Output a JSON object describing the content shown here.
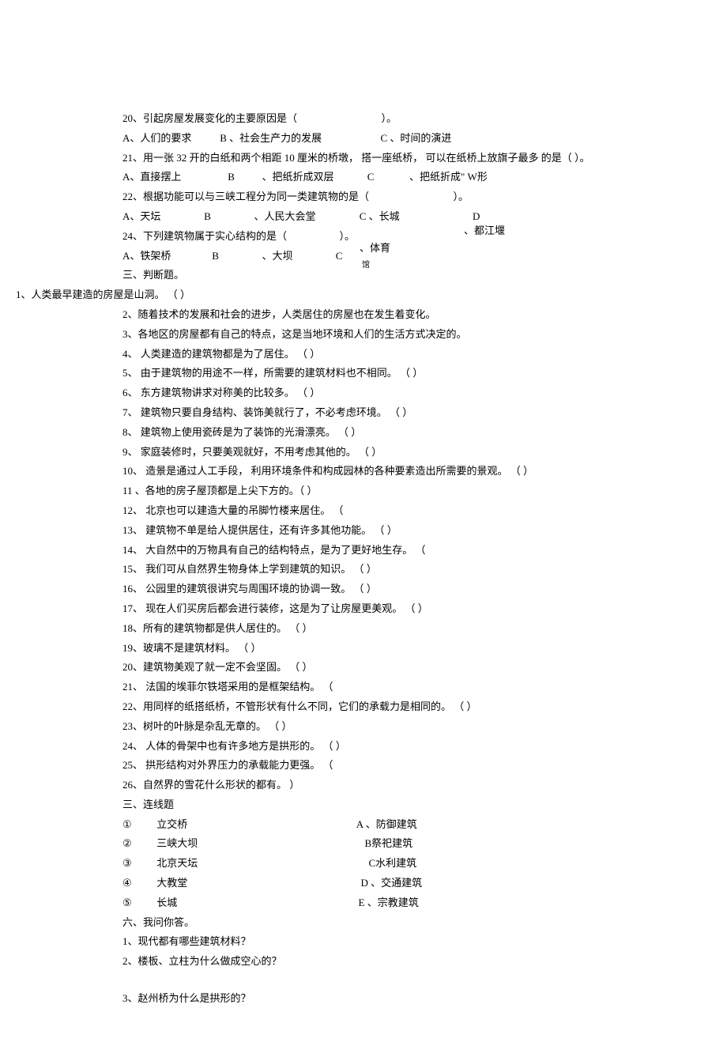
{
  "mc": {
    "q20": {
      "text": "20、引起房屋发展变化的主要原因是（",
      "close": "）。",
      "A": "A、人们的要求",
      "B": "B 、社会生产力的发展",
      "C": "C 、时间的演进"
    },
    "q21": {
      "text": "21、用一张 32 开的白纸和两个相距 10 厘米的桥墩， 搭一座纸桥， 可以在纸桥上放旗子最多 的是（ ）。",
      "A": "A、直接摆上",
      "B": "B",
      "Btext": "、把纸折成双层",
      "C": "C",
      "Ctext": "、把纸折成\" W形"
    },
    "q22": {
      "text": "22、根据功能可以与三峡工程分为同一类建筑物的是（",
      "close": "）。",
      "A": "A、天坛",
      "B": "B",
      "Btext": "、人民大会堂",
      "C": "C 、长城",
      "D": "D",
      "Dtext": "、都江堰"
    },
    "q24": {
      "text": "24、下列建筑物属于实心结构的是（",
      "close": "）。",
      "A": "A、铁架桥",
      "B": "B",
      "Btext": "、大坝",
      "C": "C",
      "Cminor": "馆",
      "Ctext": "、体育"
    }
  },
  "judge_title": "三、判断题。",
  "judge": [
    "1、人类最早建造的房屋是山洞。 （              ）",
    "2、随着技术的发展和社会的进步，人类居住的房屋也在发生着变化。",
    "3、各地区的房屋都有自己的特点，这是当地环境和人们的生活方式决定的。",
    "4、 人类建造的建筑物都是为了居住。 （   ）",
    "5、 由于建筑物的用途不一样，所需要的建筑材料也不相同。                   （   ）",
    "6、 东方建筑物讲求对称美的比较多。 （   ）",
    "7、 建筑物只要自身结构、装饰美就行了，不必考虑环境。                 （   ）",
    "8、 建筑物上使用瓷砖是为了装饰的光滑漂亮。             （   ）",
    "9、 家庭装修时，只要美观就好，不用考虑其他的。              （   ）",
    "10、 造景是通过人工手段， 利用环境条件和构成园林的各种要素造出所需要的景观。 （                               ）",
    "11 、各地的房子屋顶都是上尖下方的。（               ）",
    "12、 北京也可以建造大量的吊脚竹楼来居住。                （",
    "13、 建筑物不单是给人提供居住，还有许多其他功能。                     （   ）",
    "14、 大自然中的万物具有自己的结构特点，是为了更好地生存。                         （",
    "15、 我们可从自然界生物身体上学到建筑的知识。                 （   ）",
    "16、 公园里的建筑很讲究与周围环境的协调一致。                 （   ）",
    "17、 现在人们买房后都会进行装修，这是为了让房屋更美观。                          （   ）",
    "18、所有的建筑物都是供人居住的。 （   ）",
    "19、玻璃不是建筑材料。 （   ）",
    "20、建筑物美观了就一定不会坚固。 （                   ）",
    "21、 法国的埃菲尔铁塔采用的是框架结构。             （",
    "22、用同样的纸搭纸桥，不管形状有什么不同，它们的承载力是相同的。                                  （        ）",
    "23、树叶的叶脉是杂乱无章的。 （                ）",
    "24、 人体的骨架中也有许多地方是拱形的。                （   ）",
    "25、 拱形结构对外界压力的承载能力更强。                （",
    "26、自然界的雪花什么形状的都有。               ）"
  ],
  "match_title": "三、连线题",
  "match": [
    {
      "num": "①",
      "left": "立交桥",
      "right": "A 、防御建筑"
    },
    {
      "num": "②",
      "left": "三峡大坝",
      "right": "B祭祀建筑"
    },
    {
      "num": "③",
      "left": "北京天坛",
      "right": "C水利建筑"
    },
    {
      "num": "④",
      "left": "大教堂",
      "right": "D 、交通建筑"
    },
    {
      "num": "⑤",
      "left": "长城",
      "right": "E 、宗教建筑"
    }
  ],
  "answer_title": "六、我问你答。",
  "answers": [
    "1、现代都有哪些建筑材料？",
    "2、楼板、立柱为什么做成空心的？",
    "",
    "3、赵州桥为什么是拱形的？"
  ]
}
